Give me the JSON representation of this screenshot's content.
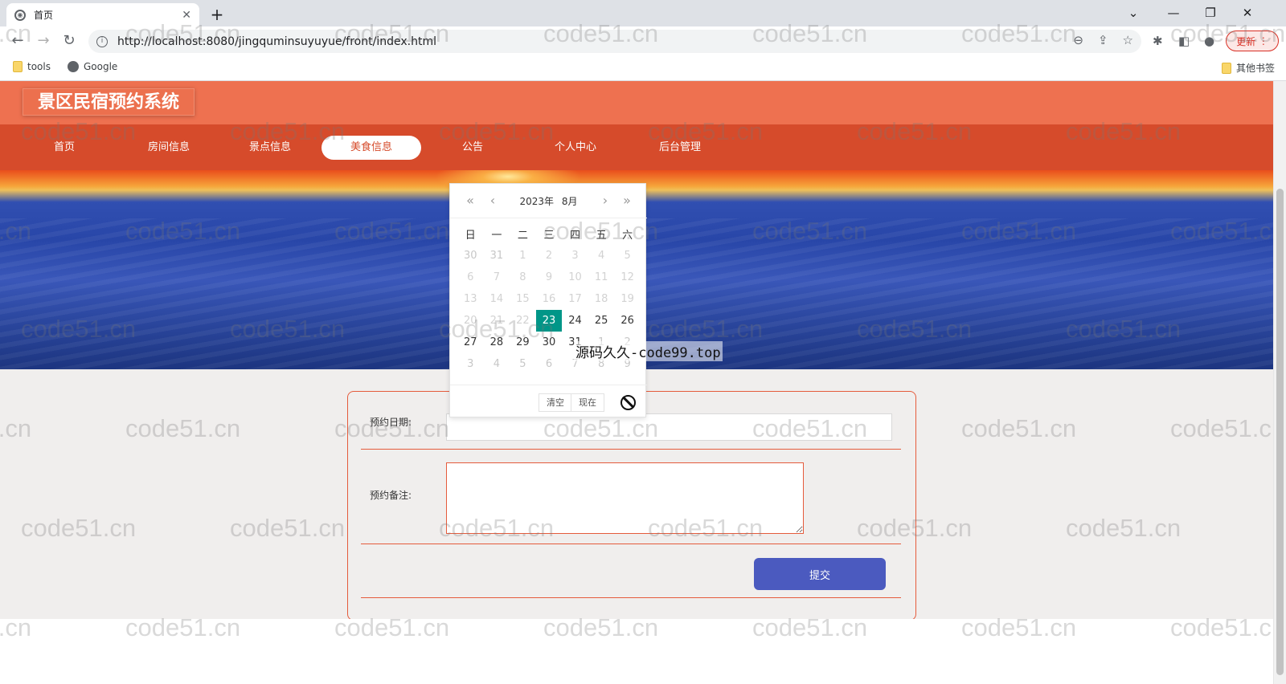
{
  "browser": {
    "tab_title": "首页",
    "tab_close": "✕",
    "new_tab": "+",
    "url": "http://localhost:8080/jingquminsuyuyue/front/index.html",
    "update_label": "更新",
    "bookmarks": [
      {
        "label": "tools",
        "icon": "folder-icon"
      },
      {
        "label": "Google",
        "icon": "globe-icon"
      }
    ],
    "other_bookmarks": "其他书签"
  },
  "site": {
    "title": "景区民宿预约系统",
    "nav": [
      {
        "label": "首页",
        "active": false
      },
      {
        "label": "房间信息",
        "active": false
      },
      {
        "label": "景点信息",
        "active": false
      },
      {
        "label": "美食信息",
        "active": true
      },
      {
        "label": "公告",
        "active": false
      },
      {
        "label": "个人中心",
        "active": false
      },
      {
        "label": "后台管理",
        "active": false
      }
    ]
  },
  "form": {
    "date_label": "预约日期:",
    "note_label": "预约备注:",
    "date_value": "",
    "note_value": "",
    "submit_label": "提交"
  },
  "datepicker": {
    "year": "2023年",
    "month": "8月",
    "weekdays": [
      "日",
      "一",
      "二",
      "三",
      "四",
      "五",
      "六"
    ],
    "weeks": [
      [
        {
          "d": "30",
          "s": "other"
        },
        {
          "d": "31",
          "s": "other"
        },
        {
          "d": "1",
          "s": "disabled"
        },
        {
          "d": "2",
          "s": "disabled"
        },
        {
          "d": "3",
          "s": "disabled"
        },
        {
          "d": "4",
          "s": "disabled"
        },
        {
          "d": "5",
          "s": "disabled"
        }
      ],
      [
        {
          "d": "6",
          "s": "disabled"
        },
        {
          "d": "7",
          "s": "disabled"
        },
        {
          "d": "8",
          "s": "disabled"
        },
        {
          "d": "9",
          "s": "disabled"
        },
        {
          "d": "10",
          "s": "disabled"
        },
        {
          "d": "11",
          "s": "disabled"
        },
        {
          "d": "12",
          "s": "disabled"
        }
      ],
      [
        {
          "d": "13",
          "s": "disabled"
        },
        {
          "d": "14",
          "s": "disabled"
        },
        {
          "d": "15",
          "s": "disabled"
        },
        {
          "d": "16",
          "s": "disabled"
        },
        {
          "d": "17",
          "s": "disabled"
        },
        {
          "d": "18",
          "s": "disabled"
        },
        {
          "d": "19",
          "s": "disabled"
        }
      ],
      [
        {
          "d": "20",
          "s": "disabled"
        },
        {
          "d": "21",
          "s": "disabled"
        },
        {
          "d": "22",
          "s": "disabled"
        },
        {
          "d": "23",
          "s": "selected"
        },
        {
          "d": "24",
          "s": "normal"
        },
        {
          "d": "25",
          "s": "normal"
        },
        {
          "d": "26",
          "s": "normal"
        }
      ],
      [
        {
          "d": "27",
          "s": "normal"
        },
        {
          "d": "28",
          "s": "normal"
        },
        {
          "d": "29",
          "s": "normal"
        },
        {
          "d": "30",
          "s": "normal"
        },
        {
          "d": "31",
          "s": "normal"
        },
        {
          "d": "1",
          "s": "other"
        },
        {
          "d": "2",
          "s": "other"
        }
      ],
      [
        {
          "d": "3",
          "s": "other"
        },
        {
          "d": "4",
          "s": "other"
        },
        {
          "d": "5",
          "s": "other"
        },
        {
          "d": "6",
          "s": "other"
        },
        {
          "d": "7",
          "s": "other"
        },
        {
          "d": "8",
          "s": "other"
        },
        {
          "d": "9",
          "s": "other"
        }
      ]
    ],
    "clear_label": "清空",
    "now_label": "现在"
  },
  "overlay": {
    "watermark": "源码久久-code99.top",
    "bg_watermark": "code51.cn"
  },
  "colors": {
    "header": "#ee7150",
    "nav": "#d64b2b",
    "selected_day": "#009688",
    "submit": "#4b5abf",
    "form_border": "#e55b3c"
  }
}
